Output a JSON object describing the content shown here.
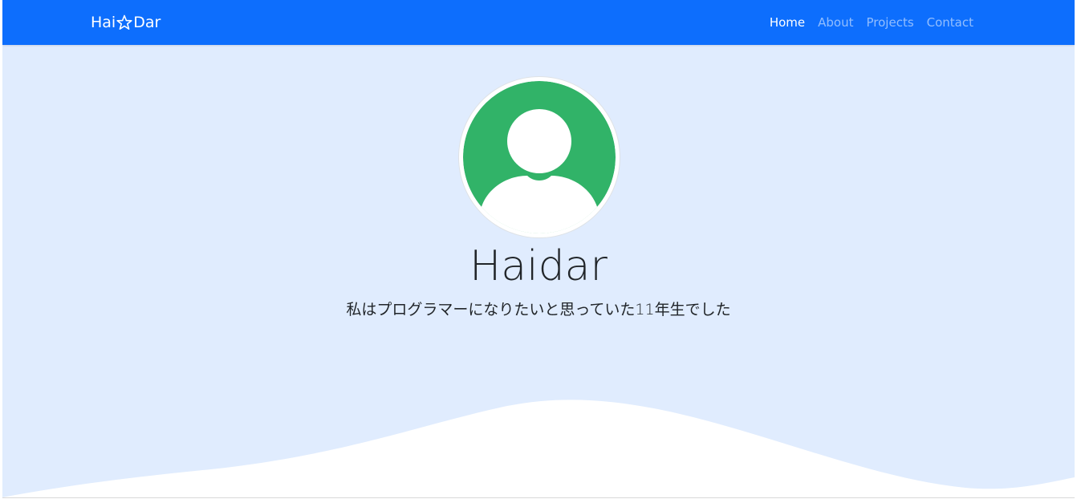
{
  "navbar": {
    "brand_prefix": "Hai",
    "brand_suffix": "Dar",
    "brand_icon": "star-icon",
    "links": [
      {
        "label": "Home",
        "active": true
      },
      {
        "label": "About",
        "active": false
      },
      {
        "label": "Projects",
        "active": false
      },
      {
        "label": "Contact",
        "active": false
      }
    ]
  },
  "hero": {
    "avatar_icon": "user-avatar-icon",
    "name": "Haidar",
    "subtitle": "私はプログラマーになりたいと思っていた11年生でした"
  },
  "colors": {
    "navbar_bg": "#0d6efd",
    "hero_bg": "#e0ecfe",
    "avatar_green": "#31b368",
    "wave": "#ffffff"
  }
}
